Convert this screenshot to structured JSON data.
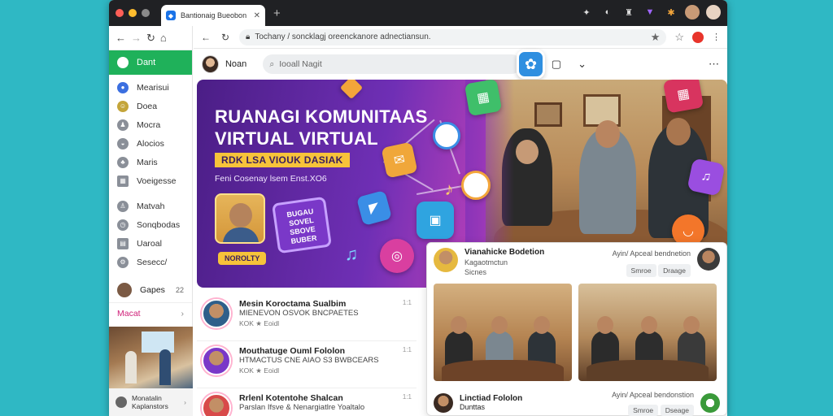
{
  "browser": {
    "tab_title": "Bantionaig Bueobon",
    "tab_close": "✕",
    "newtab": "+",
    "url": "Tochany / soncklagj oreenckanore adnectiansun.",
    "toolbar_icons": [
      "puzzle-icon",
      "shield-icon",
      "bottle-icon",
      "extension-icon",
      "extension2-icon"
    ]
  },
  "sidebar": {
    "active": "Dant",
    "items": [
      {
        "label": "Mearisui"
      },
      {
        "label": "Doea"
      },
      {
        "label": "Mocra"
      },
      {
        "label": "Alocios"
      },
      {
        "label": "Maris"
      },
      {
        "label": "Voeigesse"
      }
    ],
    "items2": [
      {
        "label": "Matvah"
      },
      {
        "label": "Sonqbodas"
      },
      {
        "label": "Uaroal"
      },
      {
        "label": "Sesecc/"
      }
    ],
    "gapes": {
      "label": "Gapes",
      "count": "22"
    },
    "category": "Macat",
    "footer": {
      "line1": "Monatalin",
      "line2": "Kaplanstors"
    }
  },
  "header": {
    "user": "Noan",
    "search_placeholder": "Iooall Nagit"
  },
  "hero": {
    "title_line1": "RUANAGI KOMUNITAAS",
    "title_line2": "VIRTUAL VIRTUAL",
    "tag": "RDK LSA VIOUK DASIAK",
    "subtitle": "Feni Cosenay lsem Enst.XO6",
    "host_label": "NOROLTY",
    "sticker": "BUGAU SOVEL SBOVE BUBER"
  },
  "feed": [
    {
      "title": "Mesin Koroctama Sualbim",
      "subtitle": "MIENEVON OSVOK BNCPAETES",
      "meta": "KOK ★ Eoidl",
      "time": "1:1"
    },
    {
      "title": "Mouthatuge Ouml Fololon",
      "subtitle": "HTMACTUS CNE AIAO S3 BWBCEARS",
      "meta": "KOK ★ Eoidl",
      "time": "1:1"
    },
    {
      "title": "Rrlenl Kotentohe Shalcan",
      "subtitle": "Parslan Ifsve & Nenargiatlre Yoaltalo",
      "meta": "",
      "time": "1:1"
    }
  ],
  "card": {
    "title": "Vianahicke Bodetion",
    "sub": "Kagaotmctun",
    "meta": "Sicnes",
    "right_label": "Ayin/ Apceal bendnetion",
    "btn1": "Smroe",
    "btn2": "Draage",
    "bottom_title": "Linctiad Fololon",
    "bottom_sub": "Dunttas",
    "bottom_right": "Ayin/ Apceal bendonstion",
    "bottom_btn1": "Smroe",
    "bottom_btn2": "Dseage"
  },
  "colors": {
    "accent_green": "#1fb15a",
    "hero_purple": "#6f2fb5",
    "tag_yellow": "#f7c33a",
    "app_blue": "#2f8fe0",
    "macat_pink": "#d0227a"
  }
}
